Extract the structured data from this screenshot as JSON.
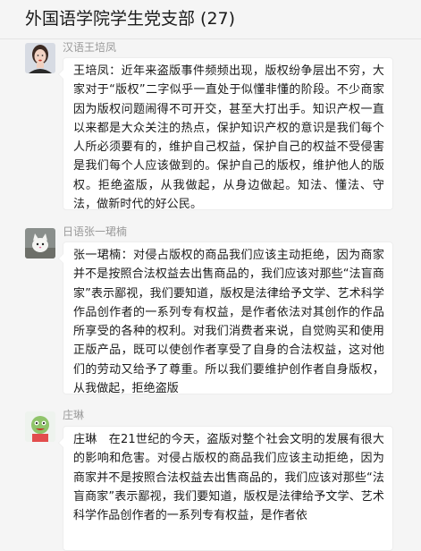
{
  "chat": {
    "title": "外国语学院学生党支部 (27)"
  },
  "messages": [
    {
      "sender": "汉语王培凤",
      "avatar_icon": "woman-portrait-avatar",
      "text": "王培凤：近年来盗版事件频频出现，版权纷争层出不穷，大家对于“版权”二字似乎一直处于似懂非懂的阶段。不少商家因为版权问题闹得不可开交，甚至大打出手。知识产权一直以来都是大众关注的热点，保护知识产权的意识是我们每个人所必须要有的，维护自己权益，保护自己的权益不受侵害是我们每个人应该做到的。保护自己的版权，维护他人的版权。拒绝盗版，从我做起，从身边做起。知法、懂法、守法，做新时代的好公民。"
    },
    {
      "sender": "日语张一珺楠",
      "avatar_icon": "cat-avatar",
      "text": "张一珺楠：对侵占版权的商品我们应该主动拒绝，因为商家并不是按照合法权益去出售商品的，我们应该对那些“法盲商家”表示鄙视，我们要知道，版权是法律给予文学、艺术科学作品创作者的一系列专有权益，是作者依法对其创作的作品所享受的各种的权利。对我们消费者来说，自觉购买和使用正版产品，既可以使创作者享受了自身的合法权益，这对他们的劳动又给予了尊重。所以我们要维护创作者自身版权，从我做起，拒绝盗版"
    },
    {
      "sender": "庄琳",
      "avatar_icon": "cartoon-character-avatar",
      "text": "庄琳　在21世纪的今天，盗版对整个社会文明的发展有很大的影响和危害。对侵占版权的商品我们应该主动拒绝，因为商家并不是按照合法权益去出售商品的，我们应该对那些“法盲商家”表示鄙视，我们要知道，版权是法律给予文学、艺术科学作品创作者的一系列专有权益，是作者依"
    }
  ]
}
